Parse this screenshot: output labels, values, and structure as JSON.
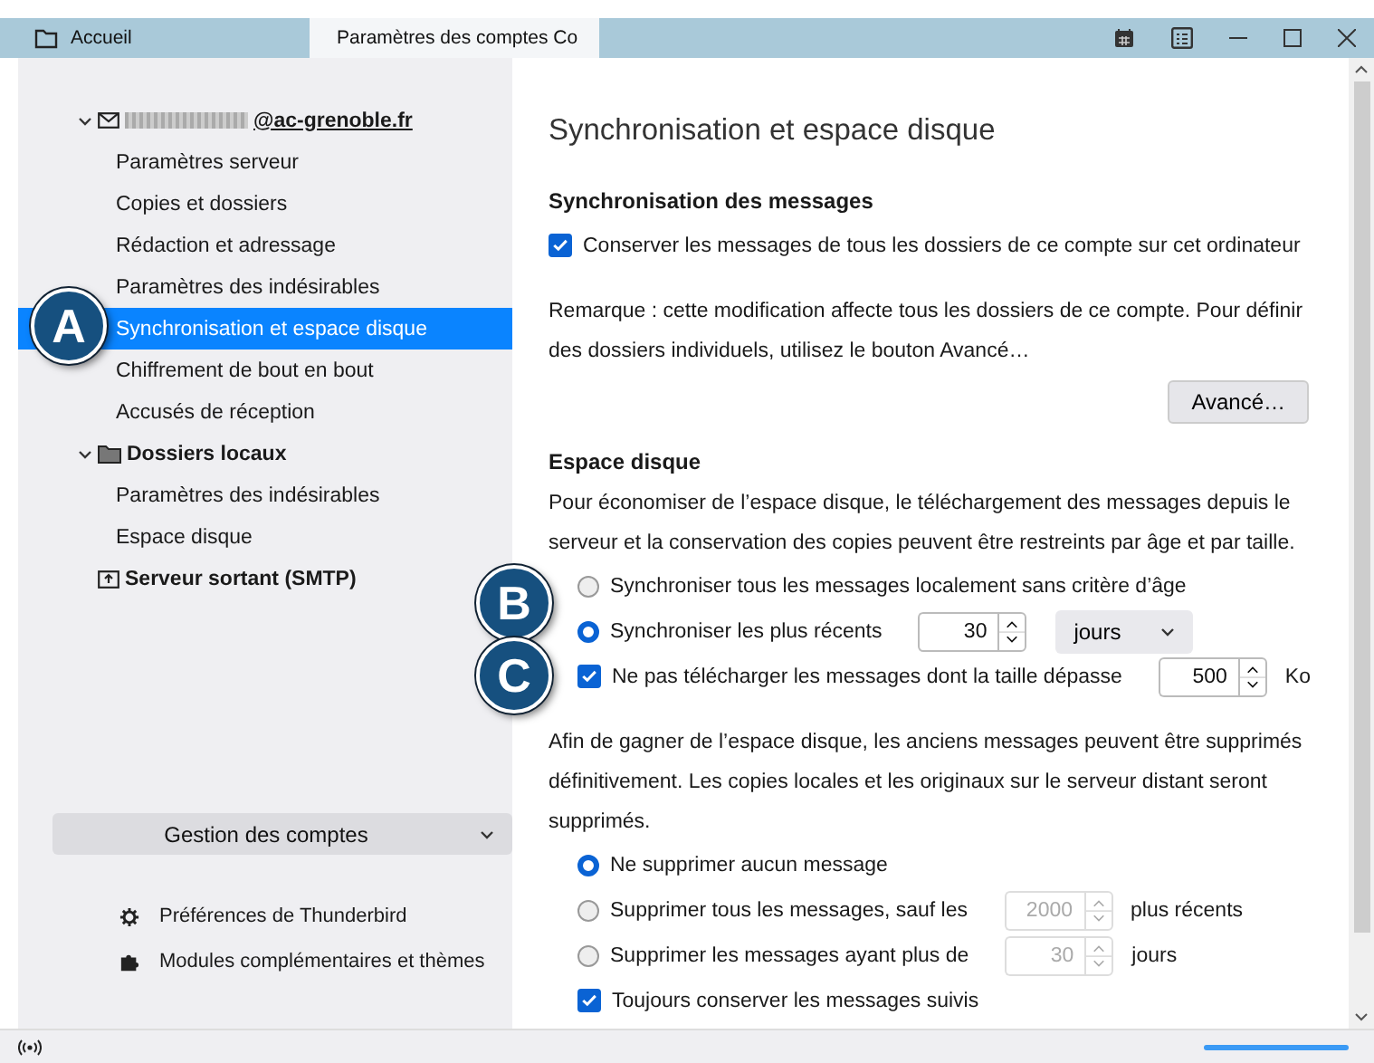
{
  "tabs": [
    {
      "label": "Accueil",
      "kind": "home",
      "selected": false
    },
    {
      "label": "Paramètres des comptes Co",
      "kind": "settings",
      "selected": true
    }
  ],
  "sidebar": {
    "tree": [
      {
        "label": "@ac-grenoble.fr",
        "kind": "account",
        "redacted": true,
        "expanded": true,
        "children": [
          {
            "label": "Paramètres serveur",
            "selected": false
          },
          {
            "label": "Copies et dossiers",
            "selected": false
          },
          {
            "label": "Rédaction et adressage",
            "selected": false
          },
          {
            "label": "Paramètres des indésirables",
            "selected": false
          },
          {
            "label": "Synchronisation et espace disque",
            "selected": true
          },
          {
            "label": "Chiffrement de bout en bout",
            "selected": false
          },
          {
            "label": "Accusés de réception",
            "selected": false
          }
        ]
      },
      {
        "label": "Dossiers locaux",
        "kind": "folder",
        "redacted": false,
        "expanded": true,
        "children": [
          {
            "label": "Paramètres des indésirables",
            "selected": false
          },
          {
            "label": "Espace disque",
            "selected": false
          }
        ]
      },
      {
        "label": "Serveur sortant (SMTP)",
        "kind": "outbox",
        "redacted": false
      }
    ],
    "manage_button": {
      "label": "Gestion des comptes"
    },
    "links": [
      {
        "label": "Préférences de Thunderbird",
        "kind": "gear"
      },
      {
        "label": "Modules complémentaires et thèmes",
        "kind": "puzzle"
      }
    ]
  },
  "page_title": "Synchronisation et espace disque",
  "sections": [
    {
      "heading": "Synchronisation des messages",
      "items": [
        {
          "kind": "checkbox",
          "label": "Conserver les messages de tous les dossiers de ce compte sur cet ordinateur",
          "checked": true
        },
        {
          "kind": "paragraph",
          "text": "Remarque : cette modification affecte tous les dossiers de ce compte. Pour définir des dossiers individuels, utilisez le bouton Avancé…"
        },
        {
          "kind": "button",
          "label": "Avancé…"
        }
      ]
    },
    {
      "heading": "Espace disque",
      "items": [
        {
          "kind": "paragraph",
          "text": "Pour économiser de l’espace disque, le téléchargement des messages depuis le serveur et la conservation des copies peuvent être restreints par âge et par taille."
        },
        {
          "kind": "radio",
          "label": "Synchroniser tous les messages localement sans critère d’âge",
          "selected": false
        },
        {
          "kind": "radio",
          "label": "Synchroniser les plus récents",
          "selected": true,
          "number": {
            "value": "30",
            "disabled": false
          },
          "dropdown": "jours"
        },
        {
          "kind": "checkbox",
          "label": "Ne pas télécharger les messages dont la taille dépasse",
          "checked": true,
          "number": {
            "value": "500",
            "disabled": false
          },
          "unit": "Ko"
        },
        {
          "kind": "paragraph",
          "text": "Afin de gagner de l’espace disque, les anciens messages peuvent être supprimés définitivement. Les copies locales et les originaux sur le serveur distant seront supprimés."
        },
        {
          "kind": "radio",
          "label": "Ne supprimer aucun message",
          "selected": true
        },
        {
          "kind": "radio",
          "label": "Supprimer tous les messages, sauf les",
          "selected": false,
          "number": {
            "value": "2000",
            "disabled": true
          },
          "unit": "plus récents"
        },
        {
          "kind": "radio",
          "label": "Supprimer les messages ayant plus de",
          "selected": false,
          "number": {
            "value": "30",
            "disabled": true
          },
          "unit": "jours"
        },
        {
          "kind": "checkbox",
          "label": "Toujours conserver les messages suivis",
          "checked": true
        }
      ]
    }
  ],
  "callouts": [
    {
      "label": "A"
    },
    {
      "label": "B"
    },
    {
      "label": "C"
    }
  ]
}
